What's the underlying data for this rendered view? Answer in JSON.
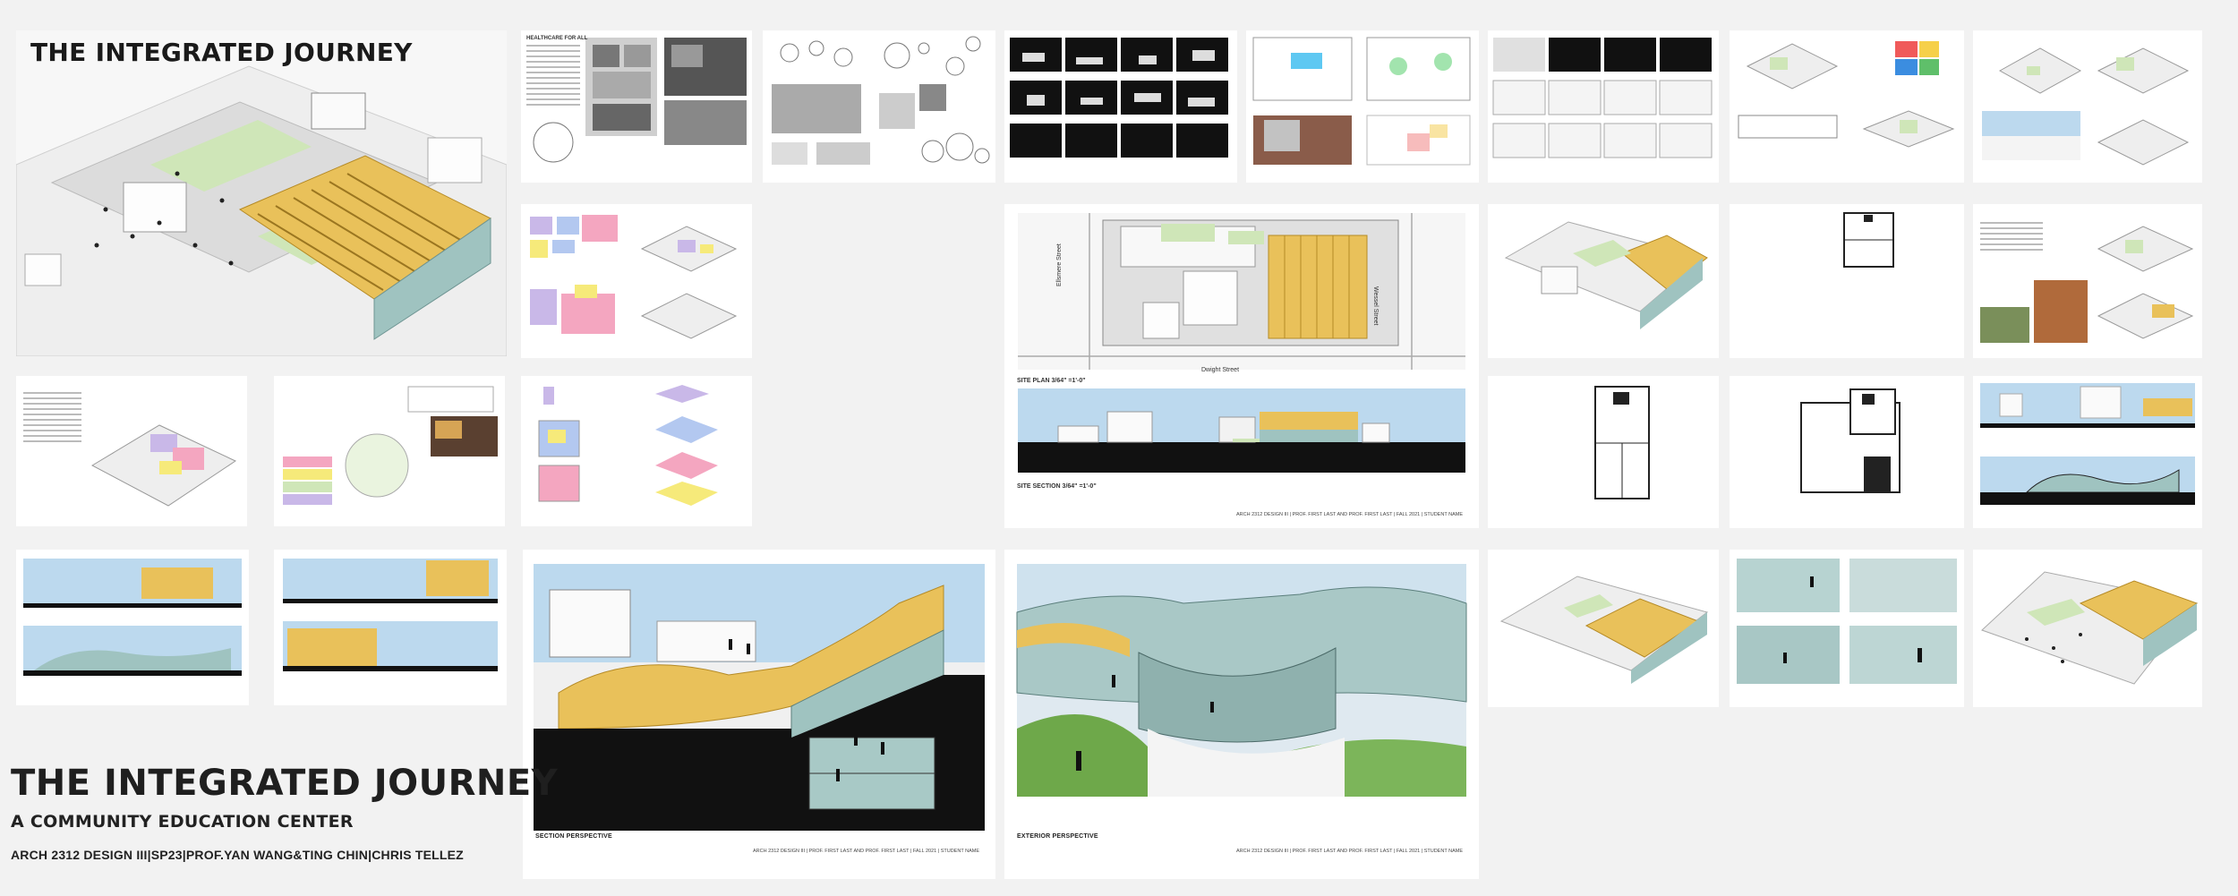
{
  "hero": {
    "title": "THE INTEGRATED JOURNEY"
  },
  "boards": {
    "healthcare": {
      "heading": "HEALTHCARE FOR ALL"
    },
    "site_plan": {
      "caption": "SITE PLAN 3/64\" =1'-0\"",
      "street_left": "Ellsmere Street",
      "street_right": "Wessel Street",
      "street_bottom": "Dwight Street"
    },
    "site_section": {
      "caption": "SITE SECTION 3/64\" =1'-0\"",
      "footer": "ARCH 2312 DESIGN III | PROF. FIRST LAST AND PROF. FIRST LAST | FALL 2021 | STUDENT NAME"
    },
    "section_perspective": {
      "caption": "SECTION PERSPECTIVE",
      "footer": "ARCH 2312 DESIGN III | PROF. FIRST LAST AND PROF. FIRST LAST | FALL 2021 | STUDENT NAME"
    },
    "exterior_perspective": {
      "caption": "EXTERIOR PERSPECTIVE",
      "footer": "ARCH 2312 DESIGN III | PROF. FIRST LAST AND PROF. FIRST LAST | FALL 2021 | STUDENT NAME"
    }
  },
  "title_block": {
    "title": "THE INTEGRATED JOURNEY",
    "subtitle": "A COMMUNITY EDUCATION CENTER",
    "course": "ARCH 2312 DESIGN III|SP23|PROF.YAN WANG&TING CHIN|CHRIS TELLEZ"
  },
  "colors": {
    "background": "#f2f2f2",
    "wood": "#e9c15a",
    "green": "#cfe6b8",
    "sky": "#bcd9ee",
    "glass": "#9fc3c0",
    "program_pink": "#f4a6c0",
    "program_purple": "#c9b8e8",
    "program_yellow": "#f6ea7a"
  }
}
